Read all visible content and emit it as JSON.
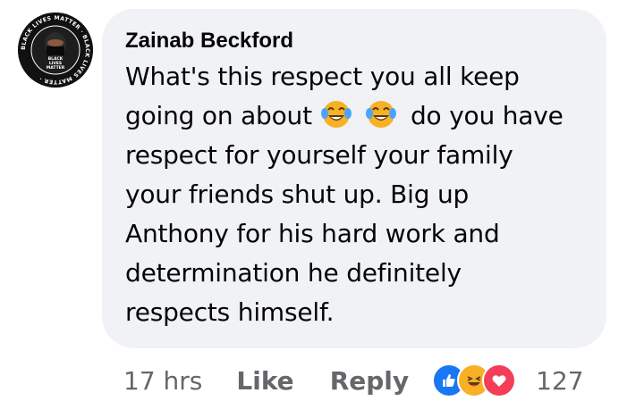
{
  "comment": {
    "author": "Zainab Beckford",
    "avatar_text": {
      "ring": "BLACK LIVES MATTER · BLACK LIVES MATTER ·",
      "center_1": "BLACK",
      "center_2": "LIVES",
      "center_3": "MATTER"
    },
    "lines": [
      "What's this respect you all keep",
      "going on about",
      "do you have",
      "respect for yourself your family",
      "your friends shut up. Big up",
      "Anthony for his hard work and",
      "determination he definitely",
      "respects himself."
    ],
    "emojis": [
      "face-with-tears-of-joy-icon",
      "face-with-tears-of-joy-icon"
    ],
    "timestamp": "17 hrs",
    "like_label": "Like",
    "reply_label": "Reply",
    "reaction_count": "127",
    "reactions": [
      "like-reaction-icon",
      "haha-reaction-icon",
      "love-reaction-icon"
    ]
  },
  "colors": {
    "bubble_bg": "#f0f2f5",
    "text": "#050505",
    "meta_text": "#65676b",
    "like_blue": "#1877f2",
    "love_red": "#f33e58",
    "haha_yellow": "#f7b125"
  }
}
